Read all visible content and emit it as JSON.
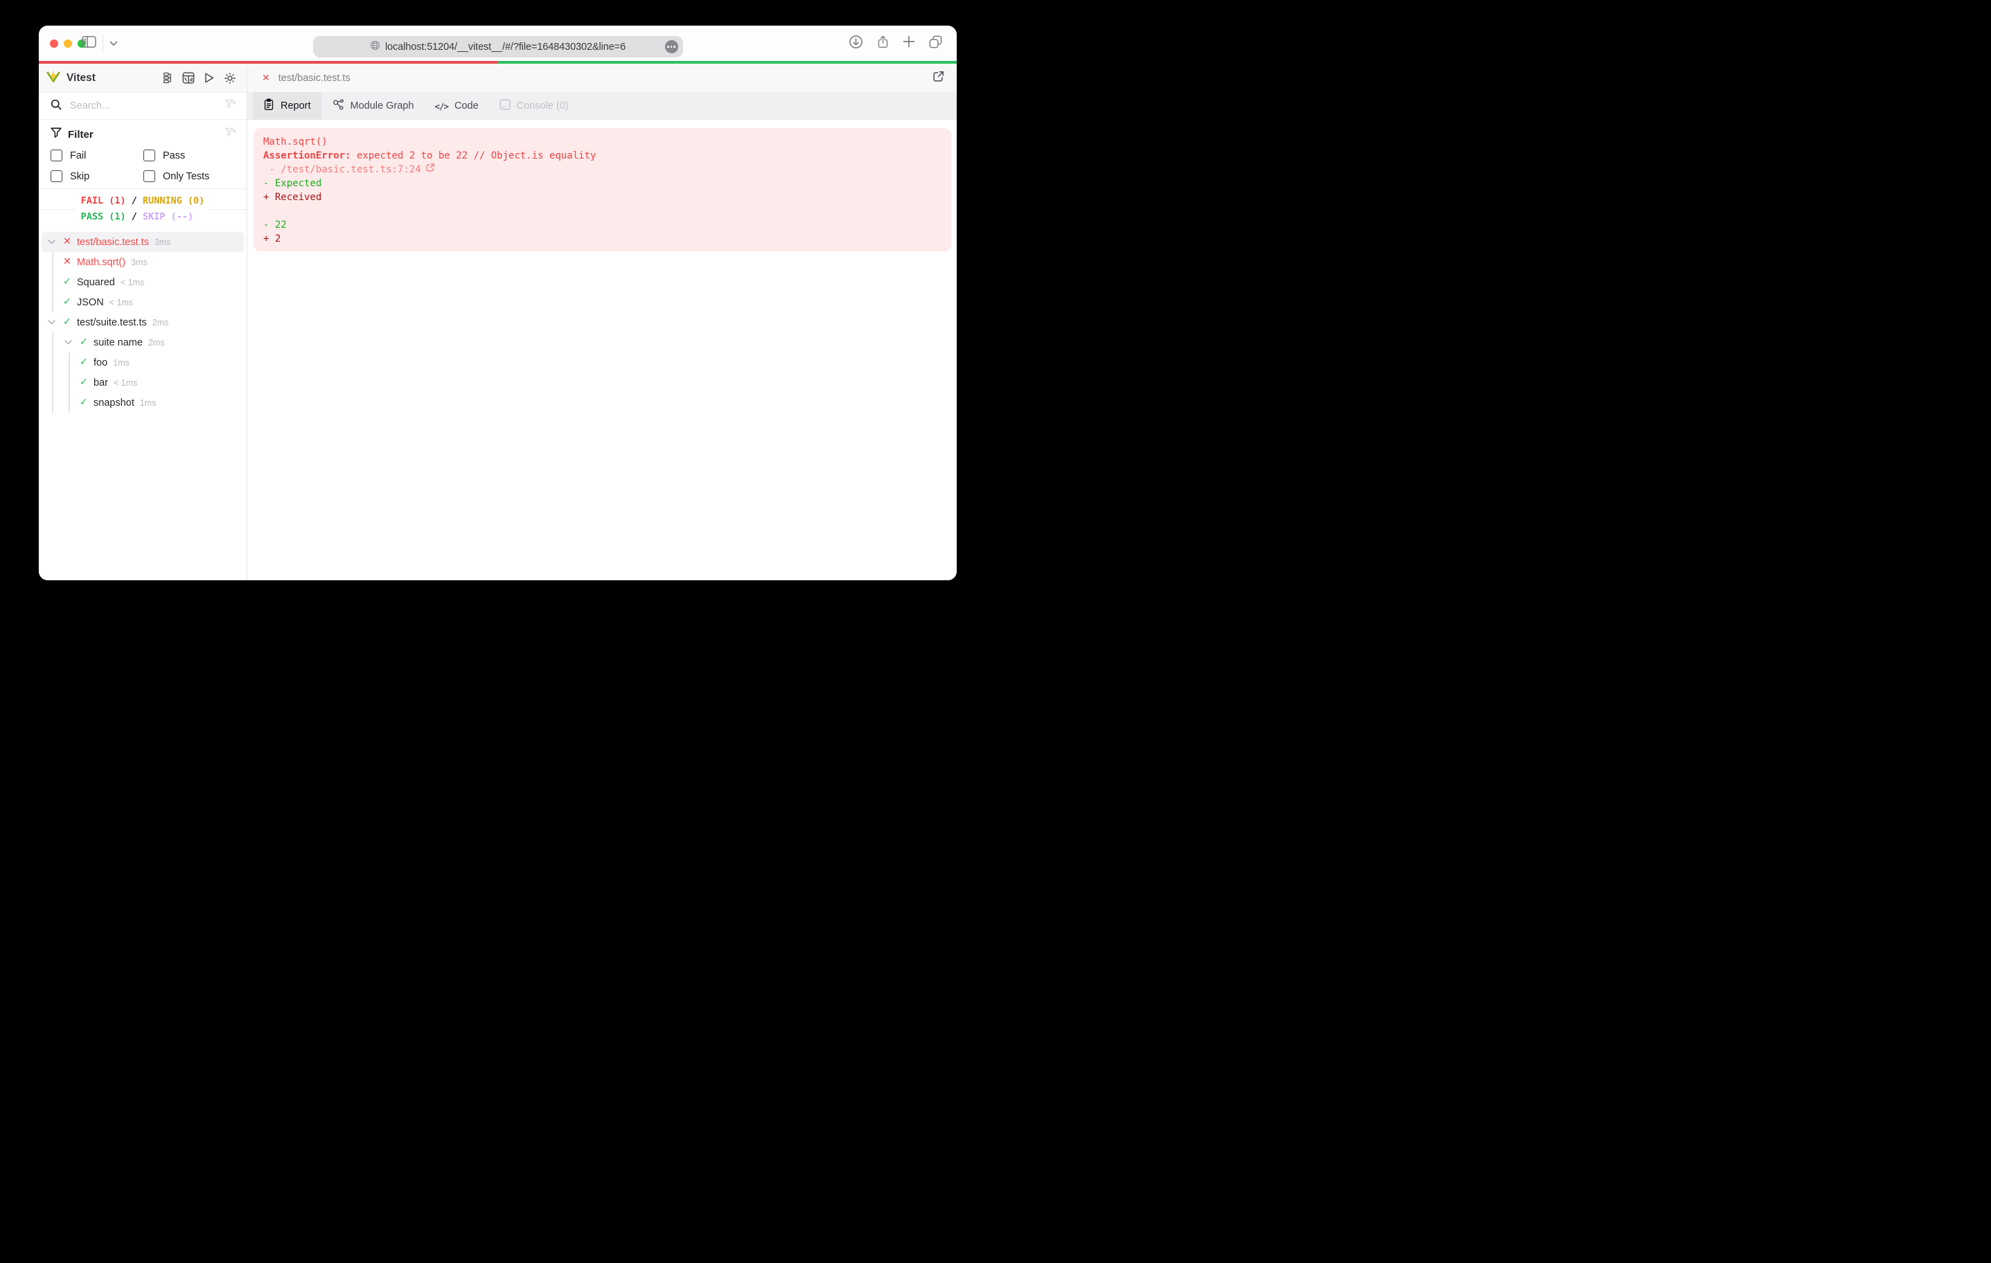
{
  "browser": {
    "url": "localhost:51204/__vitest__/#/?file=1648430302&line=6"
  },
  "progress": {
    "fail_percent": 50,
    "pass_percent": 50,
    "fail_color": "#e8494d",
    "pass_color": "#2dbe60"
  },
  "sidebar": {
    "app_title": "Vitest",
    "search_placeholder": "Search...",
    "filter": {
      "title": "Filter",
      "options": [
        {
          "label": "Fail",
          "checked": false
        },
        {
          "label": "Pass",
          "checked": false
        },
        {
          "label": "Skip",
          "checked": false
        },
        {
          "label": "Only Tests",
          "checked": false
        }
      ]
    },
    "status": {
      "fail": "FAIL (1)",
      "sep1": " / ",
      "running": "RUNNING (0)",
      "pass": "PASS (1)",
      "sep2": " / ",
      "skip": "SKIP (--)"
    },
    "tree": [
      {
        "name": "test/basic.test.ts",
        "duration": "3ms",
        "status": "fail",
        "depth": 0,
        "expandable": true,
        "selected": true
      },
      {
        "name": "Math.sqrt()",
        "duration": "3ms",
        "status": "fail",
        "depth": 1
      },
      {
        "name": "Squared",
        "duration": "< 1ms",
        "status": "pass",
        "depth": 1
      },
      {
        "name": "JSON",
        "duration": "< 1ms",
        "status": "pass",
        "depth": 1
      },
      {
        "name": "test/suite.test.ts",
        "duration": "2ms",
        "status": "pass",
        "depth": 0,
        "expandable": true
      },
      {
        "name": "suite name",
        "duration": "2ms",
        "status": "pass",
        "depth": 1,
        "expandable": true
      },
      {
        "name": "foo",
        "duration": "1ms",
        "status": "pass",
        "depth": 2
      },
      {
        "name": "bar",
        "duration": "< 1ms",
        "status": "pass",
        "depth": 2
      },
      {
        "name": "snapshot",
        "duration": "1ms",
        "status": "pass",
        "depth": 2
      }
    ]
  },
  "main": {
    "file_name": "test/basic.test.ts",
    "tabs": [
      {
        "label": "Report",
        "active": true
      },
      {
        "label": "Module Graph",
        "active": false
      },
      {
        "label": "Code",
        "active": false
      },
      {
        "label": "Console (0)",
        "active": false,
        "disabled": true
      }
    ],
    "error": {
      "test_name": "Math.sqrt()",
      "error_name": "AssertionError:",
      "error_message": " expected 2 to be 22 // Object.is equality",
      "location": " - /test/basic.test.ts:7:24",
      "diff_expected_label": "- Expected",
      "diff_received_label": "+ Received",
      "diff_expected_value": "- 22",
      "diff_received_value": "+ 2"
    }
  },
  "colors": {
    "fail": "#f04a4a",
    "pass": "#26c05d",
    "running": "#d9a406",
    "skip": "#cfa4f7",
    "error_text": "#ef4444",
    "error_link": "#f47c7c",
    "diff_green": "#1fae1f",
    "diff_dark_red": "#a71518",
    "error_background": "#fdeaea"
  }
}
